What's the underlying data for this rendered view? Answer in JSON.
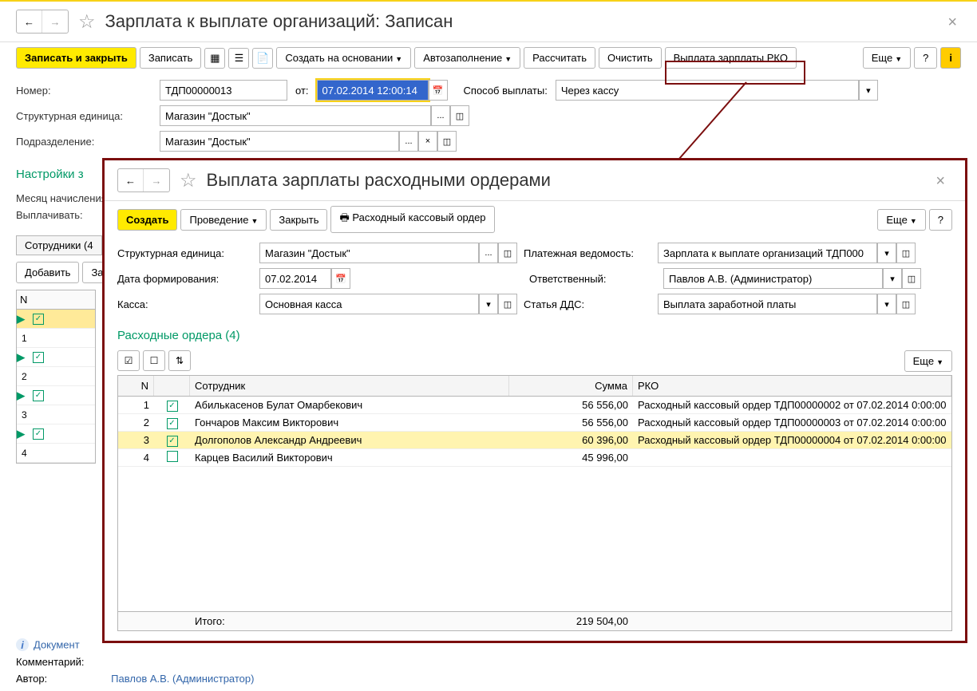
{
  "main": {
    "title": "Зарплата к выплате организаций: Записан",
    "toolbar": {
      "save_close": "Записать и закрыть",
      "save": "Записать",
      "create_based": "Создать на основании",
      "autofill": "Автозаполнение",
      "calc": "Рассчитать",
      "clear": "Очистить",
      "pay_rko": "Выплата зарплаты РКО",
      "more": "Еще",
      "help": "?"
    },
    "fields": {
      "number_label": "Номер:",
      "number_value": "ТДП00000013",
      "from_label": "от:",
      "date_value": "07.02.2014 12:00:14",
      "method_label": "Способ выплаты:",
      "method_value": "Через кассу",
      "unit_label": "Структурная единица:",
      "unit_value": "Магазин \"Достык\"",
      "dept_label": "Подразделение:",
      "dept_value": "Магазин \"Достык\"",
      "month_label": "Месяц начисления:",
      "pay_label": "Выплачивать:"
    },
    "section": "Настройки з",
    "tab": "Сотрудники (4",
    "add_btn": "Добавить",
    "za_btn": "За",
    "grid_header": "N",
    "grid_rows": [
      "1",
      "2",
      "3",
      "4"
    ],
    "doc_link": "Документ",
    "comment_label": "Комментарий:",
    "author_label": "Автор:",
    "author_value": "Павлов А.В. (Администратор)"
  },
  "modal": {
    "title": "Выплата зарплаты расходными ордерами",
    "toolbar": {
      "create": "Создать",
      "posting": "Проведение",
      "close": "Закрыть",
      "print_rko": "Расходный кассовый ордер",
      "more": "Еще",
      "help": "?"
    },
    "fields": {
      "unit_label": "Структурная единица:",
      "unit_value": "Магазин \"Достык\"",
      "doc_label": "Платежная ведомость:",
      "doc_value": "Зарплата к выплате организаций ТДП000",
      "date_label": "Дата формирования:",
      "date_value": "07.02.2014",
      "resp_label": "Ответственный:",
      "resp_value": "Павлов А.В. (Администратор)",
      "cash_label": "Касса:",
      "cash_value": "Основная касса",
      "dds_label": "Статья ДДС:",
      "dds_value": "Выплата заработной платы"
    },
    "section": "Расходные ордера (4)",
    "table": {
      "headers": {
        "n": "N",
        "emp": "Сотрудник",
        "sum": "Сумма",
        "rko": "РКО"
      },
      "rows": [
        {
          "n": "1",
          "checked": true,
          "emp": "Абилькасенов Булат Омарбекович",
          "sum": "56 556,00",
          "rko": "Расходный кассовый ордер ТДП00000002 от 07.02.2014 0:00:00",
          "highlighted": false
        },
        {
          "n": "2",
          "checked": true,
          "emp": "Гончаров Максим Викторович",
          "sum": "56 556,00",
          "rko": "Расходный кассовый ордер ТДП00000003 от 07.02.2014 0:00:00",
          "highlighted": false
        },
        {
          "n": "3",
          "checked": true,
          "emp": "Долгополов Александр Андреевич",
          "sum": "60 396,00",
          "rko": "Расходный кассовый ордер ТДП00000004 от 07.02.2014 0:00:00",
          "highlighted": true
        },
        {
          "n": "4",
          "checked": false,
          "emp": "Карцев Василий Викторович",
          "sum": "45 996,00",
          "rko": "",
          "highlighted": false
        }
      ],
      "footer": {
        "label": "Итого:",
        "sum": "219 504,00"
      }
    }
  }
}
